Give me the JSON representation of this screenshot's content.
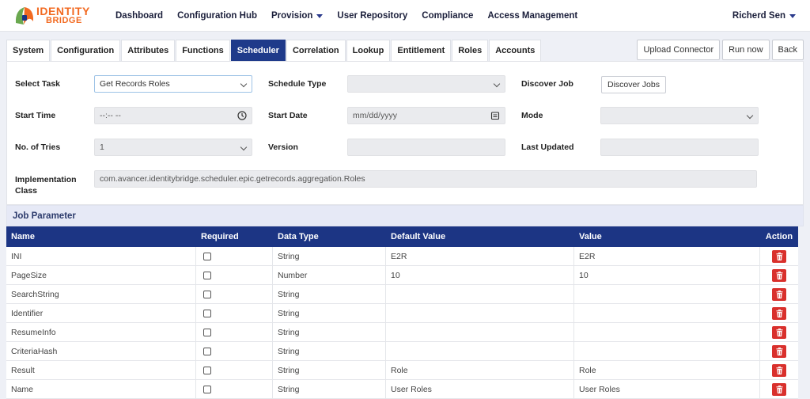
{
  "brand": {
    "line1": "IDENTITY",
    "line2": "BRIDGE"
  },
  "nav": [
    {
      "label": "Dashboard"
    },
    {
      "label": "Configuration Hub"
    },
    {
      "label": "Provision"
    },
    {
      "label": "User Repository"
    },
    {
      "label": "Compliance"
    },
    {
      "label": "Access Management"
    }
  ],
  "user": {
    "name": "Richerd Sen"
  },
  "tabs": [
    "System",
    "Configuration",
    "Attributes",
    "Functions",
    "Scheduler",
    "Correlation",
    "Lookup",
    "Entitlement",
    "Roles",
    "Accounts"
  ],
  "actions": {
    "upload": "Upload Connector",
    "run": "Run now",
    "back": "Back"
  },
  "form": {
    "select_task": {
      "label": "Select Task",
      "value": "Get Records Roles"
    },
    "schedule_type": {
      "label": "Schedule Type",
      "value": ""
    },
    "discover_job": {
      "label": "Discover Job",
      "button": "Discover Jobs"
    },
    "start_time": {
      "label": "Start Time",
      "placeholder": "--:-- --"
    },
    "start_date": {
      "label": "Start Date",
      "placeholder": "mm/dd/yyyy"
    },
    "mode": {
      "label": "Mode",
      "value": ""
    },
    "tries": {
      "label": "No. of Tries",
      "value": "1"
    },
    "version": {
      "label": "Version",
      "value": ""
    },
    "last_updated": {
      "label": "Last Updated",
      "value": ""
    },
    "impl_class": {
      "label_line1": "Implementation",
      "label_line2": "Class",
      "value": "com.avancer.identitybridge.scheduler.epic.getrecords.aggregation.Roles"
    }
  },
  "job_parameter": {
    "title": "Job Parameter",
    "columns": {
      "name": "Name",
      "required": "Required",
      "type": "Data Type",
      "default": "Default Value",
      "value": "Value",
      "action": "Action"
    },
    "rows": [
      {
        "name": "INI",
        "type": "String",
        "default": "E2R",
        "value": "E2R"
      },
      {
        "name": "PageSize",
        "type": "Number",
        "default": "10",
        "value": "10"
      },
      {
        "name": "SearchString",
        "type": "String",
        "default": "",
        "value": ""
      },
      {
        "name": "Identifier",
        "type": "String",
        "default": "",
        "value": ""
      },
      {
        "name": "ResumeInfo",
        "type": "String",
        "default": "",
        "value": ""
      },
      {
        "name": "CriteriaHash",
        "type": "String",
        "default": "",
        "value": ""
      },
      {
        "name": "Result",
        "type": "String",
        "default": "Role",
        "value": "Role"
      },
      {
        "name": "Name",
        "type": "String",
        "default": "User Roles",
        "value": "User Roles"
      }
    ]
  },
  "colors": {
    "primary": "#1c3584",
    "accent": "#f26a21",
    "danger": "#d9302c"
  }
}
